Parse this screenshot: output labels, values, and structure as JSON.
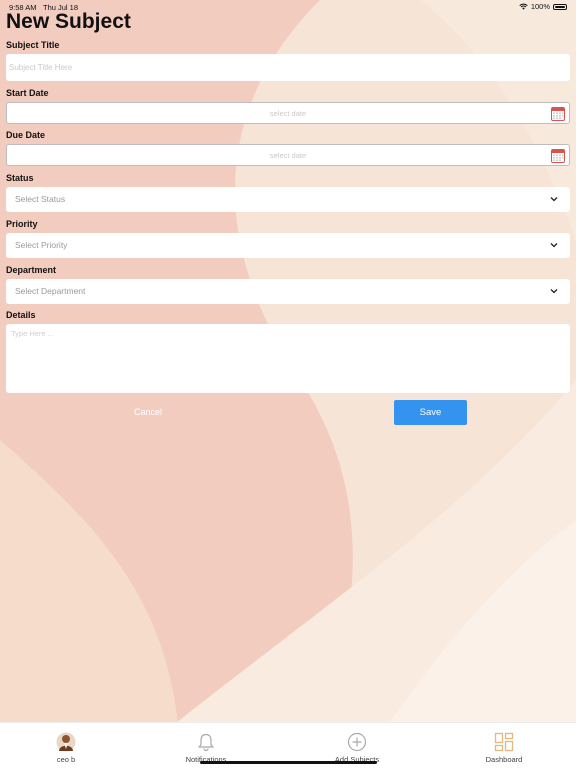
{
  "status_bar": {
    "time": "9:58 AM",
    "date": "Thu Jul 18",
    "battery": "100%"
  },
  "page": {
    "title": "New Subject"
  },
  "form": {
    "subject_title": {
      "label": "Subject Title",
      "placeholder": "Subject Title Here"
    },
    "start_date": {
      "label": "Start Date",
      "placeholder": "select date",
      "icon": "calendar-icon"
    },
    "due_date": {
      "label": "Due Date",
      "placeholder": "select date",
      "icon": "calendar-icon"
    },
    "status": {
      "label": "Status",
      "placeholder": "Select Status"
    },
    "priority": {
      "label": "Priority",
      "placeholder": "Select Priority"
    },
    "department": {
      "label": "Department",
      "placeholder": "Select Department"
    },
    "details": {
      "label": "Details",
      "placeholder": "Type Here ..."
    }
  },
  "actions": {
    "cancel_label": "Cancel",
    "save_label": "Save"
  },
  "tab_bar": {
    "items": [
      {
        "label": "ceo b",
        "icon": "avatar"
      },
      {
        "label": "Notifications",
        "icon": "bell-icon"
      },
      {
        "label": "Add Subjects",
        "icon": "plus-circle-icon"
      },
      {
        "label": "Dashboard",
        "icon": "dashboard-icon"
      }
    ]
  },
  "colors": {
    "accent": "#3593f0",
    "dashboard_icon": "#e3b77f",
    "calendar_red": "#d9534f"
  }
}
